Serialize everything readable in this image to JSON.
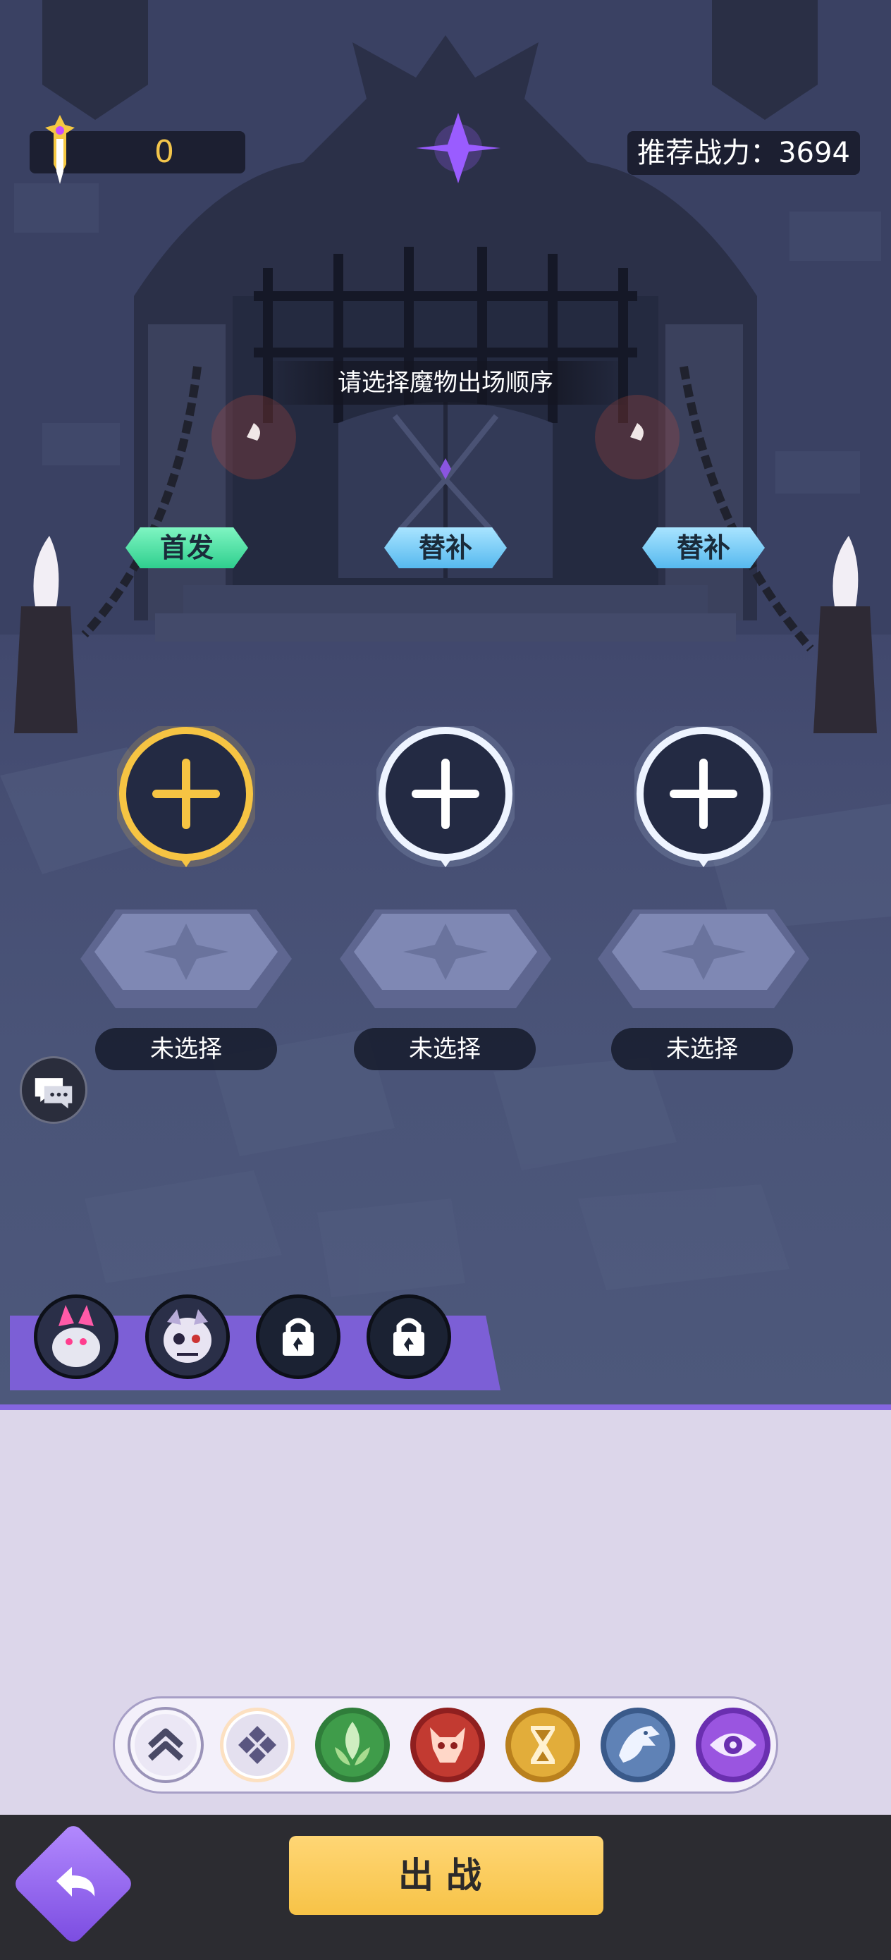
{
  "header": {
    "power_value": "0",
    "recommended_power": "推荐战力：3694"
  },
  "hint": "请选择魔物出场顺序",
  "slots": [
    {
      "tag": "首发",
      "label": "未选择"
    },
    {
      "tag": "替补",
      "label": "未选择"
    },
    {
      "tag": "替补",
      "label": "未选择"
    }
  ],
  "team_bar": {
    "slots": [
      "pink-monster-avatar",
      "skull-monster-avatar",
      "locked",
      "locked"
    ]
  },
  "filters": [
    "upgrade-icon",
    "all-icon",
    "nature-icon",
    "demon-icon",
    "hourglass-icon",
    "dragon-icon",
    "eye-icon"
  ],
  "battle_button": "出战",
  "colors": {
    "selected_ring": "#f6c443",
    "default_ring": "#cfe2ff",
    "accent_purple": "#8566e0",
    "battle_button": "#f7c347",
    "first_tag": "#2fcf8e",
    "sub_tag": "#56b9ef"
  }
}
